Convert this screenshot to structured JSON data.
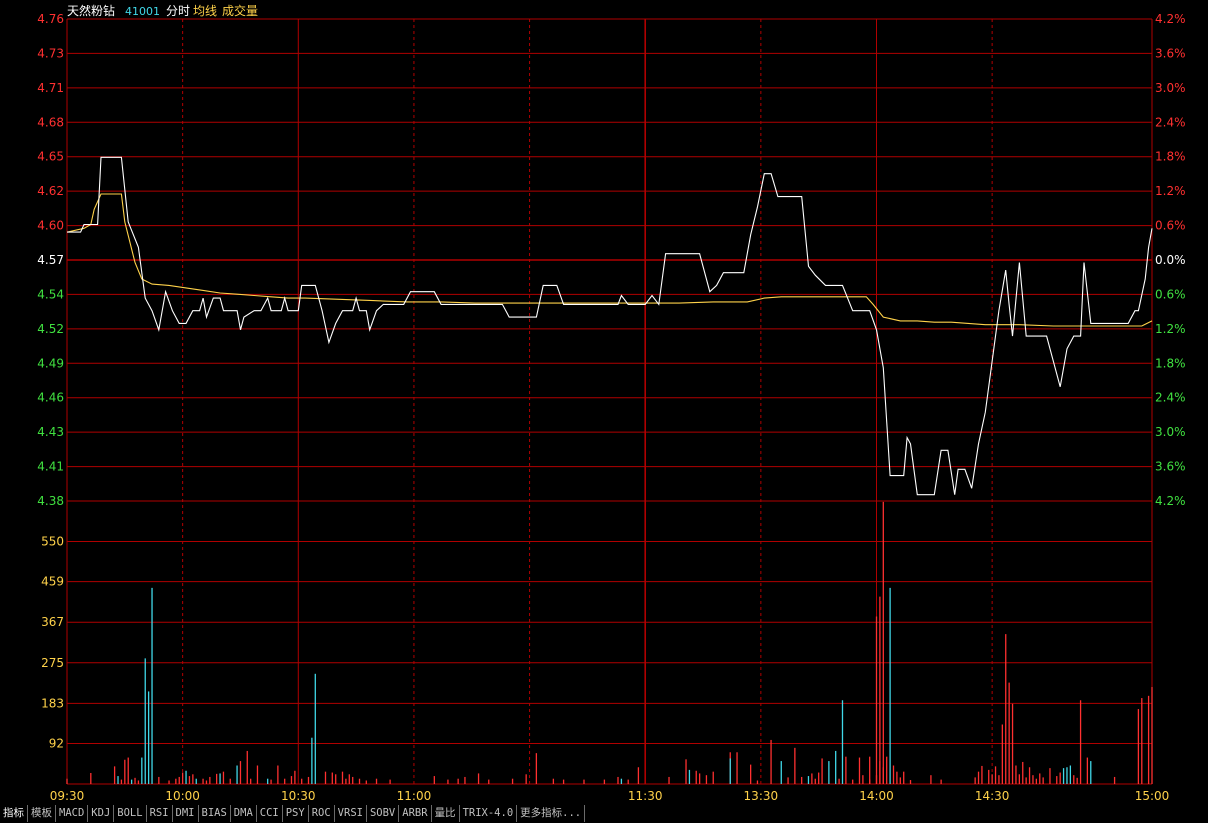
{
  "header": {
    "name": "天然粉钻",
    "code": "41001",
    "mode": "分时",
    "avg_label": "均线",
    "vol_label": "成交量"
  },
  "colors": {
    "background": "#000000",
    "grid": "#b00000",
    "price_line": "#ffffff",
    "avg_line": "#ffd24a",
    "up": "#ff3030",
    "down": "#40e040",
    "neutral": "#ffffff",
    "vol_up": "#ff3030",
    "vol_down": "#40d8e8",
    "time_label": "#ffd24a",
    "vol_label": "#ffd24a"
  },
  "chart_data": {
    "type": "line",
    "prev_close": 4.57,
    "price_ylim": [
      4.38,
      4.76
    ],
    "price_ticks": [
      "4.76",
      "4.73",
      "4.71",
      "4.68",
      "4.65",
      "4.62",
      "4.60",
      "4.57",
      "4.54",
      "4.52",
      "4.49",
      "4.46",
      "4.43",
      "4.41",
      "4.38"
    ],
    "pct_ticks": [
      "4.2%",
      "3.6%",
      "3.0%",
      "2.4%",
      "1.8%",
      "1.2%",
      "0.6%",
      "0.0%",
      "0.6%",
      "1.2%",
      "1.8%",
      "2.4%",
      "3.0%",
      "3.6%",
      "4.2%"
    ],
    "vol_ylim": [
      0,
      642
    ],
    "vol_ticks": [
      "550",
      "459",
      "367",
      "275",
      "183",
      "92"
    ],
    "time_ticks": [
      "09:30",
      "10:00",
      "10:30",
      "11:00",
      "11:30",
      "13:30",
      "14:00",
      "14:30",
      "15:00"
    ],
    "price_series": [
      [
        0,
        4.592
      ],
      [
        4,
        4.592
      ],
      [
        5,
        4.598
      ],
      [
        9,
        4.598
      ],
      [
        10,
        4.651
      ],
      [
        16,
        4.651
      ],
      [
        18,
        4.6
      ],
      [
        21,
        4.58
      ],
      [
        23,
        4.54
      ],
      [
        25,
        4.53
      ],
      [
        27,
        4.515
      ],
      [
        29,
        4.545
      ],
      [
        31,
        4.53
      ],
      [
        33,
        4.52
      ],
      [
        35,
        4.52
      ],
      [
        37,
        4.53
      ],
      [
        39,
        4.53
      ],
      [
        40,
        4.54
      ],
      [
        41,
        4.525
      ],
      [
        43,
        4.54
      ],
      [
        45,
        4.54
      ],
      [
        46,
        4.53
      ],
      [
        48,
        4.53
      ],
      [
        50,
        4.53
      ],
      [
        51,
        4.515
      ],
      [
        52,
        4.525
      ],
      [
        55,
        4.53
      ],
      [
        57,
        4.53
      ],
      [
        59,
        4.54
      ],
      [
        60,
        4.53
      ],
      [
        63,
        4.53
      ],
      [
        64,
        4.54
      ],
      [
        65,
        4.53
      ],
      [
        68,
        4.53
      ],
      [
        69,
        4.55
      ],
      [
        71,
        4.55
      ],
      [
        73,
        4.55
      ],
      [
        75,
        4.53
      ],
      [
        77,
        4.505
      ],
      [
        79,
        4.52
      ],
      [
        81,
        4.53
      ],
      [
        83,
        4.53
      ],
      [
        84,
        4.53
      ],
      [
        85,
        4.54
      ],
      [
        86,
        4.53
      ],
      [
        88,
        4.53
      ],
      [
        89,
        4.515
      ],
      [
        91,
        4.53
      ],
      [
        93,
        4.535
      ],
      [
        95,
        4.535
      ],
      [
        99,
        4.535
      ],
      [
        101,
        4.545
      ],
      [
        105,
        4.545
      ],
      [
        108,
        4.545
      ],
      [
        110,
        4.535
      ],
      [
        112,
        4.535
      ],
      [
        120,
        4.535
      ],
      [
        128,
        4.535
      ],
      [
        130,
        4.525
      ],
      [
        131,
        4.525
      ],
      [
        138,
        4.525
      ],
      [
        140,
        4.55
      ],
      [
        144,
        4.55
      ],
      [
        146,
        4.535
      ],
      [
        152,
        4.535
      ],
      [
        155,
        4.535
      ],
      [
        160,
        4.535
      ],
      [
        162,
        4.535
      ],
      [
        163,
        4.542
      ],
      [
        165,
        4.535
      ],
      [
        170,
        4.535
      ],
      [
        172,
        4.542
      ],
      [
        174,
        4.535
      ],
      [
        176,
        4.575
      ],
      [
        180,
        4.575
      ],
      [
        186,
        4.575
      ],
      [
        189,
        4.545
      ],
      [
        191,
        4.55
      ],
      [
        193,
        4.56
      ],
      [
        195,
        4.56
      ],
      [
        199,
        4.56
      ],
      [
        201,
        4.59
      ],
      [
        203,
        4.612
      ],
      [
        205,
        4.638
      ],
      [
        207,
        4.638
      ],
      [
        209,
        4.62
      ],
      [
        212,
        4.62
      ],
      [
        216,
        4.62
      ],
      [
        218,
        4.565
      ],
      [
        220,
        4.558
      ],
      [
        223,
        4.55
      ],
      [
        228,
        4.55
      ],
      [
        231,
        4.53
      ],
      [
        233,
        4.53
      ],
      [
        236,
        4.53
      ],
      [
        238,
        4.515
      ],
      [
        240,
        4.485
      ],
      [
        242,
        4.4
      ],
      [
        244,
        4.4
      ],
      [
        246,
        4.4
      ],
      [
        247,
        4.43
      ],
      [
        248,
        4.425
      ],
      [
        250,
        4.385
      ],
      [
        252,
        4.385
      ],
      [
        255,
        4.385
      ],
      [
        257,
        4.42
      ],
      [
        259,
        4.42
      ],
      [
        261,
        4.385
      ],
      [
        262,
        4.405
      ],
      [
        264,
        4.405
      ],
      [
        266,
        4.39
      ],
      [
        268,
        4.425
      ],
      [
        270,
        4.45
      ],
      [
        272,
        4.49
      ],
      [
        274,
        4.53
      ],
      [
        276,
        4.562
      ],
      [
        277,
        4.535
      ],
      [
        278,
        4.51
      ],
      [
        280,
        4.568
      ],
      [
        282,
        4.51
      ],
      [
        286,
        4.51
      ],
      [
        288,
        4.51
      ],
      [
        290,
        4.49
      ],
      [
        292,
        4.47
      ],
      [
        294,
        4.5
      ],
      [
        296,
        4.51
      ],
      [
        298,
        4.51
      ],
      [
        299,
        4.568
      ],
      [
        301,
        4.52
      ],
      [
        305,
        4.52
      ],
      [
        310,
        4.52
      ],
      [
        312,
        4.52
      ],
      [
        314,
        4.53
      ],
      [
        315,
        4.53
      ],
      [
        317,
        4.555
      ],
      [
        318,
        4.58
      ],
      [
        319,
        4.595
      ]
    ],
    "avg_series": [
      [
        0,
        4.592
      ],
      [
        5,
        4.595
      ],
      [
        7,
        4.598
      ],
      [
        8,
        4.61
      ],
      [
        10,
        4.622
      ],
      [
        14,
        4.622
      ],
      [
        16,
        4.622
      ],
      [
        17,
        4.6
      ],
      [
        20,
        4.568
      ],
      [
        22,
        4.555
      ],
      [
        25,
        4.551
      ],
      [
        30,
        4.55
      ],
      [
        35,
        4.548
      ],
      [
        40,
        4.546
      ],
      [
        45,
        4.544
      ],
      [
        50,
        4.543
      ],
      [
        55,
        4.542
      ],
      [
        60,
        4.541
      ],
      [
        65,
        4.54
      ],
      [
        70,
        4.54
      ],
      [
        80,
        4.539
      ],
      [
        90,
        4.538
      ],
      [
        100,
        4.537
      ],
      [
        110,
        4.537
      ],
      [
        120,
        4.536
      ],
      [
        130,
        4.536
      ],
      [
        140,
        4.536
      ],
      [
        150,
        4.536
      ],
      [
        160,
        4.536
      ],
      [
        170,
        4.536
      ],
      [
        180,
        4.536
      ],
      [
        190,
        4.537
      ],
      [
        200,
        4.537
      ],
      [
        205,
        4.54
      ],
      [
        210,
        4.541
      ],
      [
        220,
        4.541
      ],
      [
        230,
        4.541
      ],
      [
        235,
        4.541
      ],
      [
        237,
        4.535
      ],
      [
        240,
        4.525
      ],
      [
        245,
        4.522
      ],
      [
        250,
        4.522
      ],
      [
        255,
        4.521
      ],
      [
        260,
        4.521
      ],
      [
        265,
        4.52
      ],
      [
        270,
        4.519
      ],
      [
        280,
        4.519
      ],
      [
        290,
        4.518
      ],
      [
        300,
        4.518
      ],
      [
        310,
        4.518
      ],
      [
        316,
        4.518
      ],
      [
        319,
        4.522
      ]
    ],
    "volume_series": [
      [
        0,
        12,
        1
      ],
      [
        7,
        25,
        1
      ],
      [
        14,
        40,
        1
      ],
      [
        15,
        18,
        0
      ],
      [
        16,
        10,
        1
      ],
      [
        17,
        55,
        1
      ],
      [
        18,
        60,
        1
      ],
      [
        19,
        10,
        0
      ],
      [
        20,
        14,
        1
      ],
      [
        21,
        8,
        1
      ],
      [
        22,
        60,
        0
      ],
      [
        23,
        285,
        0
      ],
      [
        24,
        210,
        0
      ],
      [
        25,
        445,
        0
      ],
      [
        27,
        16,
        1
      ],
      [
        30,
        8,
        1
      ],
      [
        32,
        12,
        1
      ],
      [
        33,
        16,
        1
      ],
      [
        34,
        26,
        1
      ],
      [
        35,
        30,
        0
      ],
      [
        36,
        18,
        1
      ],
      [
        37,
        22,
        1
      ],
      [
        38,
        12,
        0
      ],
      [
        40,
        12,
        1
      ],
      [
        41,
        8,
        1
      ],
      [
        42,
        16,
        1
      ],
      [
        44,
        23,
        1
      ],
      [
        45,
        24,
        0
      ],
      [
        46,
        28,
        1
      ],
      [
        48,
        12,
        1
      ],
      [
        50,
        42,
        0
      ],
      [
        51,
        52,
        1
      ],
      [
        53,
        75,
        1
      ],
      [
        54,
        12,
        1
      ],
      [
        56,
        42,
        1
      ],
      [
        59,
        12,
        0
      ],
      [
        60,
        10,
        1
      ],
      [
        62,
        42,
        1
      ],
      [
        64,
        12,
        1
      ],
      [
        66,
        18,
        1
      ],
      [
        67,
        30,
        1
      ],
      [
        69,
        12,
        1
      ],
      [
        71,
        16,
        1
      ],
      [
        72,
        105,
        0
      ],
      [
        73,
        250,
        0
      ],
      [
        76,
        28,
        1
      ],
      [
        78,
        26,
        1
      ],
      [
        79,
        22,
        1
      ],
      [
        81,
        28,
        1
      ],
      [
        82,
        12,
        1
      ],
      [
        83,
        22,
        1
      ],
      [
        84,
        16,
        1
      ],
      [
        86,
        12,
        1
      ],
      [
        88,
        8,
        1
      ],
      [
        91,
        12,
        1
      ],
      [
        95,
        10,
        1
      ],
      [
        108,
        18,
        1
      ],
      [
        112,
        10,
        1
      ],
      [
        115,
        12,
        1
      ],
      [
        117,
        16,
        1
      ],
      [
        121,
        24,
        1
      ],
      [
        124,
        10,
        1
      ],
      [
        131,
        12,
        1
      ],
      [
        135,
        22,
        1
      ],
      [
        138,
        70,
        1
      ],
      [
        143,
        12,
        1
      ],
      [
        146,
        10,
        1
      ],
      [
        152,
        10,
        1
      ],
      [
        158,
        10,
        1
      ],
      [
        162,
        16,
        1
      ],
      [
        163,
        12,
        0
      ],
      [
        165,
        10,
        1
      ],
      [
        168,
        38,
        1
      ],
      [
        177,
        16,
        1
      ],
      [
        182,
        56,
        1
      ],
      [
        183,
        32,
        0
      ],
      [
        185,
        30,
        1
      ],
      [
        186,
        24,
        1
      ],
      [
        188,
        20,
        1
      ],
      [
        190,
        28,
        1
      ],
      [
        195,
        72,
        1
      ],
      [
        195,
        58,
        0
      ],
      [
        197,
        72,
        1
      ],
      [
        201,
        44,
        1
      ],
      [
        203,
        8,
        1
      ],
      [
        207,
        100,
        1
      ],
      [
        210,
        52,
        0
      ],
      [
        212,
        15,
        1
      ],
      [
        214,
        82,
        1
      ],
      [
        216,
        16,
        1
      ],
      [
        218,
        18,
        0
      ],
      [
        219,
        24,
        1
      ],
      [
        220,
        12,
        1
      ],
      [
        221,
        26,
        1
      ],
      [
        222,
        58,
        1
      ],
      [
        224,
        52,
        0
      ],
      [
        226,
        75,
        0
      ],
      [
        227,
        12,
        1
      ],
      [
        228,
        190,
        0
      ],
      [
        229,
        62,
        1
      ],
      [
        231,
        10,
        1
      ],
      [
        233,
        60,
        1
      ],
      [
        234,
        20,
        1
      ],
      [
        236,
        10,
        1
      ],
      [
        236,
        62,
        1
      ],
      [
        238,
        20,
        1
      ],
      [
        238,
        380,
        1
      ],
      [
        239,
        52,
        1
      ],
      [
        239,
        425,
        1
      ],
      [
        240,
        38,
        1
      ],
      [
        240,
        640,
        1
      ],
      [
        241,
        62,
        1
      ],
      [
        242,
        445,
        0
      ],
      [
        243,
        42,
        1
      ],
      [
        244,
        28,
        1
      ],
      [
        245,
        15,
        1
      ],
      [
        246,
        28,
        1
      ],
      [
        248,
        9,
        1
      ],
      [
        254,
        20,
        1
      ],
      [
        257,
        10,
        1
      ],
      [
        267,
        15,
        1
      ],
      [
        268,
        28,
        1
      ],
      [
        269,
        41,
        1
      ],
      [
        271,
        32,
        1
      ],
      [
        272,
        22,
        1
      ],
      [
        273,
        40,
        1
      ],
      [
        274,
        20,
        1
      ],
      [
        275,
        135,
        1
      ],
      [
        276,
        340,
        1
      ],
      [
        277,
        230,
        1
      ],
      [
        278,
        182,
        1
      ],
      [
        279,
        42,
        1
      ],
      [
        280,
        22,
        1
      ],
      [
        281,
        50,
        1
      ],
      [
        282,
        15,
        1
      ],
      [
        283,
        38,
        1
      ],
      [
        284,
        20,
        1
      ],
      [
        285,
        12,
        1
      ],
      [
        286,
        24,
        1
      ],
      [
        287,
        15,
        1
      ],
      [
        289,
        36,
        1
      ],
      [
        291,
        18,
        1
      ],
      [
        292,
        26,
        1
      ],
      [
        293,
        36,
        0
      ],
      [
        294,
        38,
        0
      ],
      [
        295,
        42,
        0
      ],
      [
        296,
        20,
        1
      ],
      [
        297,
        14,
        1
      ],
      [
        298,
        190,
        1
      ],
      [
        300,
        60,
        1
      ],
      [
        301,
        52,
        0
      ],
      [
        308,
        16,
        1
      ],
      [
        315,
        170,
        1
      ],
      [
        316,
        195,
        1
      ],
      [
        318,
        200,
        1
      ],
      [
        319,
        220,
        1
      ]
    ]
  },
  "bottom_tabs": [
    "指标",
    "模板",
    "MACD",
    "KDJ",
    "BOLL",
    "RSI",
    "DMI",
    "BIAS",
    "DMA",
    "CCI",
    "PSY",
    "ROC",
    "VRSI",
    "SOBV",
    "ARBR",
    "量比",
    "TRIX-4.0",
    "更多指标..."
  ]
}
